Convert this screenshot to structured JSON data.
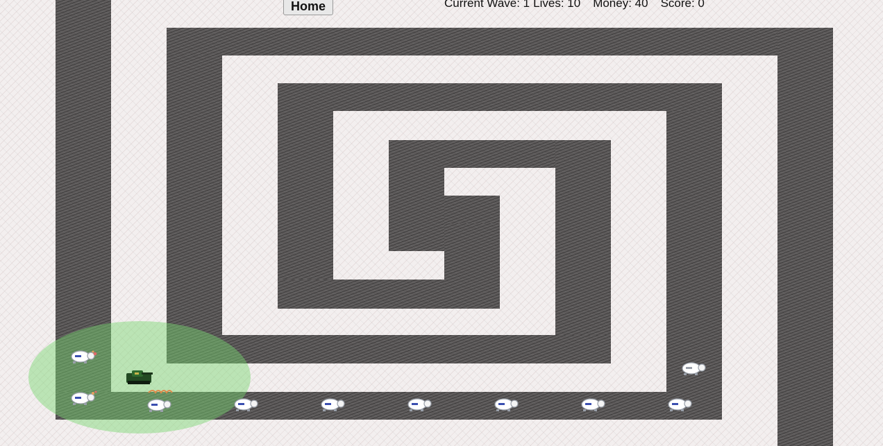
{
  "header": {
    "home_label": "Home",
    "wave_label": "Current Wave: 1",
    "lives_label": "Lives: 10",
    "money_label": "Money: 40",
    "score_label": "Score: 0"
  },
  "game": {
    "wave": 1,
    "lives": 10,
    "money": 40,
    "score": 0,
    "colors": {
      "path": "#5e5b5b",
      "ground": "#f3efef",
      "tower_range": "#78d76e",
      "tower": "#234a23",
      "creep": "#ffffff"
    },
    "enemy_icon": "turtle-creep-icon",
    "tower_icon": "tank-tower-icon",
    "enemy_count": 10
  }
}
